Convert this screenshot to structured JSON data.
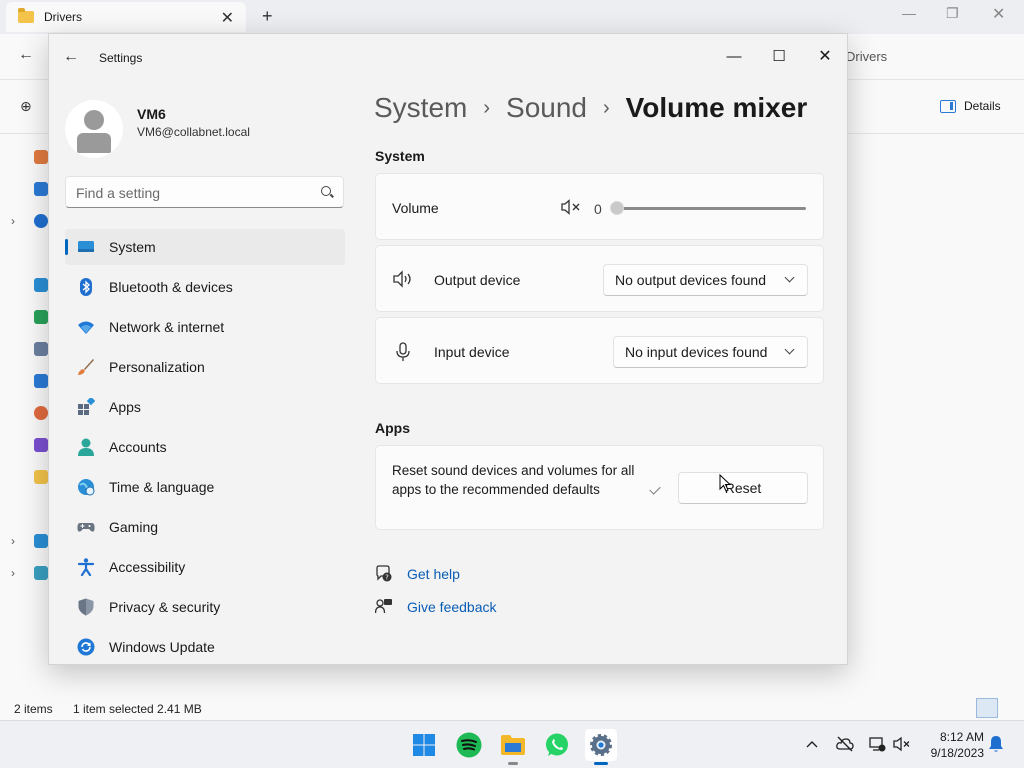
{
  "explorer": {
    "tab_title": "Drivers",
    "address_tail": "Drivers",
    "details_label": "Details",
    "status_items": "2 items",
    "status_selected": "1 item selected  2.41 MB"
  },
  "settings": {
    "window_title": "Settings",
    "user": {
      "name": "VM6",
      "email": "VM6@collabnet.local"
    },
    "search_placeholder": "Find a setting",
    "nav": [
      {
        "label": "System",
        "icon": "system-icon",
        "active": true
      },
      {
        "label": "Bluetooth & devices",
        "icon": "bluetooth-icon"
      },
      {
        "label": "Network & internet",
        "icon": "wifi-icon"
      },
      {
        "label": "Personalization",
        "icon": "brush-icon"
      },
      {
        "label": "Apps",
        "icon": "apps-icon"
      },
      {
        "label": "Accounts",
        "icon": "person-icon"
      },
      {
        "label": "Time & language",
        "icon": "globe-clock-icon"
      },
      {
        "label": "Gaming",
        "icon": "gamepad-icon"
      },
      {
        "label": "Accessibility",
        "icon": "accessibility-icon"
      },
      {
        "label": "Privacy & security",
        "icon": "shield-icon"
      },
      {
        "label": "Windows Update",
        "icon": "update-icon"
      }
    ],
    "breadcrumb": {
      "level1": "System",
      "level2": "Sound",
      "current": "Volume mixer",
      "separator": "›"
    },
    "system_section": "System",
    "volume": {
      "label": "Volume",
      "value": "0",
      "level": 0
    },
    "output_device": {
      "label": "Output device",
      "selected": "No output devices found"
    },
    "input_device": {
      "label": "Input device",
      "selected": "No input devices found"
    },
    "apps_section": "Apps",
    "reset": {
      "text": "Reset sound devices and volumes for all apps to the recommended defaults",
      "button": "Reset"
    },
    "links": {
      "help": "Get help",
      "feedback": "Give feedback"
    },
    "accent_color": "#0067c0"
  },
  "taskbar": {
    "time": "8:12 AM",
    "date": "9/18/2023"
  }
}
